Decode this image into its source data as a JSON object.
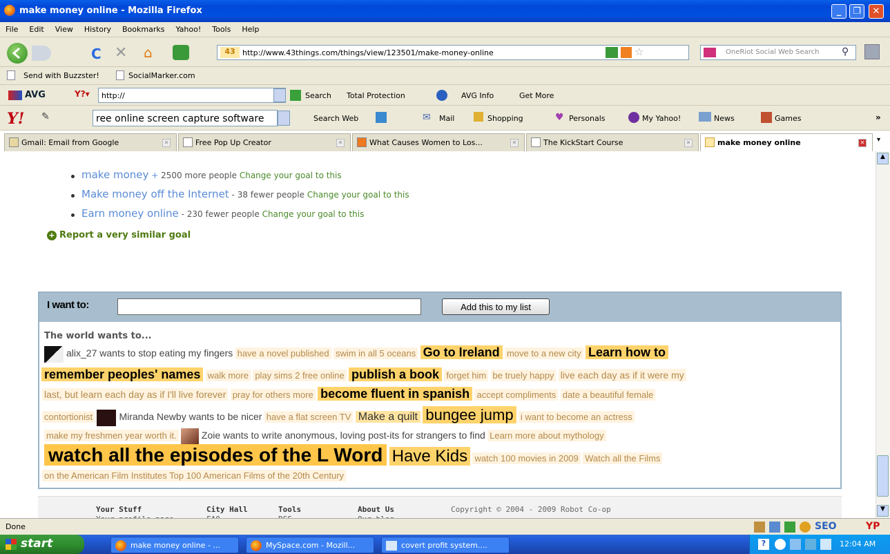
{
  "window": {
    "title": "make money online - Mozilla Firefox"
  },
  "menu": [
    "File",
    "Edit",
    "View",
    "History",
    "Bookmarks",
    "Yahoo!",
    "Tools",
    "Help"
  ],
  "nav": {
    "url": "http://www.43things.com/things/view/123501/make-money-online",
    "site_badge": "43",
    "search_placeholder": "OneRiot Social Web Search"
  },
  "bookmarks": [
    "Send with Buzzster!",
    "SocialMarker.com"
  ],
  "avg": {
    "logo": "AVG",
    "url_value": "http://",
    "items": [
      "Search",
      "Total Protection",
      "AVG Info",
      "Get More"
    ]
  },
  "yahoo": {
    "search_value": "ree online screen capture software",
    "items": [
      "Search Web",
      "Mail",
      "Shopping",
      "Personals",
      "My Yahoo!",
      "News",
      "Games"
    ],
    "more": "»"
  },
  "tabs": [
    "Gmail: Email from Google",
    "Free Pop Up Creator",
    "What Causes Women to Los...",
    "The KickStart Course",
    "make money online"
  ],
  "goals": [
    {
      "title": "make money",
      "sep": "+",
      "delta": "2500 more people",
      "action": "Change your goal to this"
    },
    {
      "title": "Make money off the Internet",
      "sep": "-",
      "delta": "38 fewer people",
      "action": "Change your goal to this"
    },
    {
      "title": "Earn money online",
      "sep": "-",
      "delta": "230 fewer people",
      "action": "Change your goal to this"
    }
  ],
  "report": "Report a very similar goal",
  "want": {
    "label": "I want to:",
    "input_value": "",
    "button": "Add this to my list"
  },
  "world": {
    "heading": "The world wants to...",
    "line1": [
      "alix_27 wants to stop eating my fingers",
      "have a novel published",
      "swim in all 5 oceans",
      "Go to Ireland",
      "move to a new city",
      "Learn how to"
    ],
    "line2": [
      "remember peoples' names",
      "walk more",
      "play sims 2 free online",
      "publish a book",
      "forget him",
      "be truely happy",
      "live each day as if it were my"
    ],
    "line3": [
      "last, but learn each day as if I'll live forever",
      "pray for others more",
      "become fluent in spanish",
      "accept compliments",
      "date a beautiful female"
    ],
    "line4": [
      "contortionist",
      "Miranda Newby wants to be nicer",
      "have a flat screen TV",
      "Make a quilt",
      "bungee jump",
      "i want to become an actress"
    ],
    "line5": [
      "make my freshmen year worth it.",
      "Zoie wants to write anonymous, loving post-its for strangers to find",
      "Learn more about mythology"
    ],
    "line6": [
      "watch all the episodes of the L Word",
      "Have Kids",
      "watch 100 movies in 2009",
      "Watch all the Films"
    ],
    "line7": [
      "on the American Film Institutes Top 100 American Films of the 20th Century"
    ]
  },
  "footer": {
    "cols": [
      "Your Stuff",
      "City Hall",
      "Tools",
      "About Us"
    ],
    "subs": [
      "Your profile page",
      "FAQ",
      "RSS",
      "Our blog"
    ],
    "copyright": "Copyright © 2004 - 2009 Robot Co-op"
  },
  "status": {
    "text": "Done",
    "seo": "SEO",
    "yp": "YP"
  },
  "taskbar": {
    "start": "start",
    "items": [
      "make money online - ...",
      "MySpace.com - Mozill...",
      "covert profit system...."
    ],
    "clock": "12:04 AM"
  }
}
